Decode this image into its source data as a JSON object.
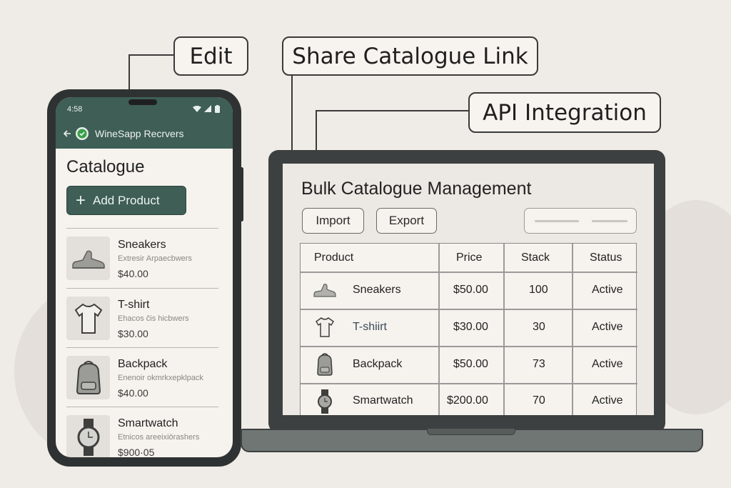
{
  "callouts": {
    "edit": "Edit",
    "share": "Share Catalogue Link",
    "api": "API Integration"
  },
  "phone": {
    "status_time": "4:58",
    "app_title": "WineSapp Recrvers",
    "catalogue_title": "Catalogue",
    "add_button_icon": "+",
    "add_button_label": "Add Product",
    "products": [
      {
        "name": "Sneakers",
        "desc": "Extresir Arpaecbwers",
        "price": "$40.00",
        "icon": "sneaker-icon"
      },
      {
        "name": "T-shirt",
        "desc": "Ehacos čis hicbwers",
        "price": "$30.00",
        "icon": "tshirt-icon"
      },
      {
        "name": "Backpack",
        "desc": "Enenoir okmrkxepklpack",
        "price": "$40.00",
        "icon": "backpack-icon"
      },
      {
        "name": "Smartwatch",
        "desc": "Etnicos areeixiörashers",
        "price": "$900·05",
        "icon": "smartwatch-icon"
      }
    ]
  },
  "laptop": {
    "title": "Bulk Catalogue Management",
    "import_label": "Import",
    "export_label": "Export",
    "columns": [
      "Product",
      "Price",
      "Stack",
      "Status"
    ],
    "rows": [
      {
        "product": "Sneakers",
        "price": "$50.00",
        "stock": "100",
        "status": "Active",
        "icon": "sneaker-icon"
      },
      {
        "product": "T-shiirt",
        "price": "$30.00",
        "stock": "30",
        "status": "Active",
        "icon": "tshirt-icon"
      },
      {
        "product": "Backpack",
        "price": "$50.00",
        "stock": "73",
        "status": "Active",
        "icon": "backpack-icon"
      },
      {
        "product": "Smartwatch",
        "price": "$200.00",
        "stock": "70",
        "status": "Active",
        "icon": "smartwatch-icon"
      }
    ]
  },
  "colors": {
    "accent": "#3e5e56",
    "background": "#efebe7",
    "device": "#3d4040"
  }
}
